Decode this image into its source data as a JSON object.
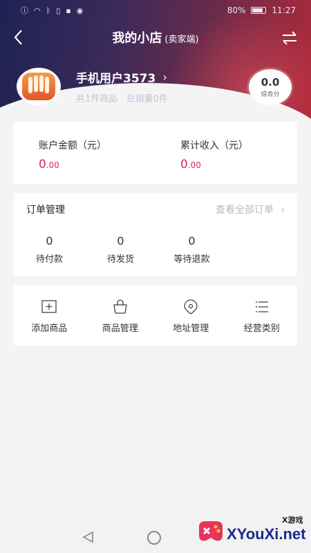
{
  "status_bar": {
    "battery": "80%",
    "time": "11:27"
  },
  "header": {
    "title": "我的小店",
    "title_suffix": "(卖家端)"
  },
  "profile": {
    "username": "手机用户3573",
    "product_count": "共1件商品",
    "total_sales": "总销量0件",
    "score_value": "0.0",
    "score_label": "综合分"
  },
  "balance": {
    "account_label": "账户金额（元）",
    "account_int": "0",
    "account_dec": ".00",
    "income_label": "累计收入（元）",
    "income_int": "0",
    "income_dec": ".00"
  },
  "orders": {
    "title": "订单管理",
    "view_all": "查看全部订单",
    "stats": [
      {
        "count": "0",
        "label": "待付款"
      },
      {
        "count": "0",
        "label": "待发货"
      },
      {
        "count": "0",
        "label": "等待退款"
      }
    ]
  },
  "tools": [
    {
      "label": "添加商品",
      "icon": "add-product-icon"
    },
    {
      "label": "商品管理",
      "icon": "shopping-bag-icon"
    },
    {
      "label": "地址管理",
      "icon": "location-pin-icon"
    },
    {
      "label": "经营类别",
      "icon": "list-icon"
    }
  ],
  "watermark": {
    "brand": "XYouXi.net",
    "small": "X游戏"
  },
  "colors": {
    "accent": "#d42a5a",
    "header_dark": "#1f2253",
    "header_red": "#b02a3a"
  }
}
